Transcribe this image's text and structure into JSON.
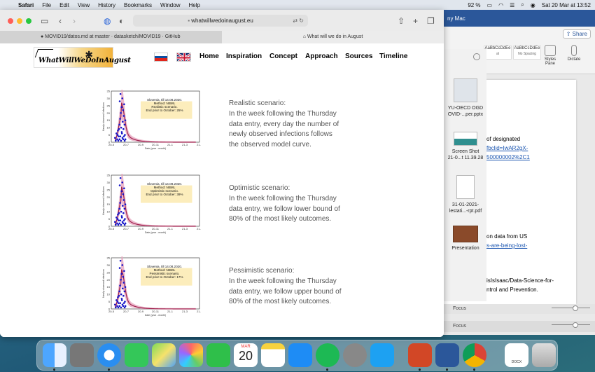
{
  "menubar": {
    "app": "Safari",
    "items": [
      "File",
      "Edit",
      "View",
      "History",
      "Bookmarks",
      "Window",
      "Help"
    ],
    "battery": "92 %",
    "datetime": "Sat 20 Mar at 13:52"
  },
  "browser": {
    "address": "whatwillwedoinaugust.eu",
    "tabs": [
      {
        "label": "MOVID19/datos.md at master · datasketch/MOVID19 · GitHub"
      },
      {
        "label": "What will we do in August"
      }
    ]
  },
  "site": {
    "logo_text": "WhatWillWeDoInAugust",
    "nav": [
      "Home",
      "Inspiration",
      "Concept",
      "Approach",
      "Sources",
      "Timeline"
    ]
  },
  "chart_common": {
    "ylabel": "Newly observed infections",
    "xlabel": "Date (year - month)",
    "yticks": [
      0,
      5,
      10,
      15,
      20,
      25,
      30,
      35
    ],
    "xticks": [
      "20-5",
      "20-7",
      "20-9",
      "20-11",
      "21-1",
      "21-3",
      "21-5"
    ],
    "points": [
      [
        0.5,
        3
      ],
      [
        0.6,
        1
      ],
      [
        0.7,
        6
      ],
      [
        0.8,
        2
      ],
      [
        0.9,
        8
      ],
      [
        1.0,
        4
      ],
      [
        1.1,
        12
      ],
      [
        1.15,
        28
      ],
      [
        1.2,
        16
      ],
      [
        1.25,
        33
      ],
      [
        1.3,
        20
      ],
      [
        1.35,
        10
      ],
      [
        1.4,
        24
      ],
      [
        1.45,
        6
      ],
      [
        1.5,
        30
      ],
      [
        1.55,
        14
      ],
      [
        1.6,
        22
      ],
      [
        1.65,
        9
      ],
      [
        1.7,
        18
      ],
      [
        1.75,
        26
      ],
      [
        1.8,
        12
      ],
      [
        1.85,
        5
      ],
      [
        1.9,
        15
      ],
      [
        0.95,
        1
      ],
      [
        1.05,
        9
      ],
      [
        0.85,
        5
      ],
      [
        1.12,
        2
      ],
      [
        1.22,
        4
      ],
      [
        1.32,
        1
      ],
      [
        1.42,
        7
      ],
      [
        1.52,
        3
      ],
      [
        1.62,
        2
      ],
      [
        1.72,
        4
      ],
      [
        1.82,
        1
      ],
      [
        1.92,
        2
      ]
    ]
  },
  "scenarios": [
    {
      "chart_title": "Slovenia, till 14.08.2020.",
      "chart_method": "Method: NBML",
      "chart_scenario": "Realistic scenario.",
      "chart_end": "End prior to October: 25%",
      "title": "Realistic scenario:",
      "lines": [
        "In the week following the Thursday",
        "data entry, every day the number of",
        "newly observed infections follows",
        "the observed model curve."
      ]
    },
    {
      "chart_title": "Slovenia, till 14.08.2020.",
      "chart_method": "Method: NBML",
      "chart_scenario": "Optimistic scenario.",
      "chart_end": "End prior to October: 39%",
      "title": "Optimistic scenario:",
      "lines": [
        "In the week following the Thursday",
        "data entry, we follow lower bound of",
        "80% of the most likely outcomes."
      ]
    },
    {
      "chart_title": "Slovenia, till 14.08.2020.",
      "chart_method": "Method: NBML",
      "chart_scenario": "Pessimistic scenario.",
      "chart_end": "End prior to October: 17%",
      "title": "Pessimistic scenario:",
      "lines": [
        "In the week following the Thursday",
        "data entry, we follow upper bound of",
        "80% of the most likely outcomes."
      ]
    }
  ],
  "word": {
    "title": "ny Mac",
    "share": "Share",
    "style1": "AaBbCcDdEe",
    "style1_label": "al",
    "style2": "AaBbCcDdEe",
    "style2_label": "No Spacing",
    "styles_pane": "Styles Pane",
    "dictate": "Dictate",
    "doc_lines": [
      {
        "text": "of designated",
        "link": false
      },
      {
        "text": "fbclid=IwAR2gX-",
        "link": true
      },
      {
        "text": "500000002%2C1",
        "link": true
      },
      {
        "text": "on data from US",
        "link": false
      },
      {
        "text": "s-are-being-lost-",
        "link": true
      },
      {
        "text": "isIsIsaac/Data-Science-for-",
        "link": false
      },
      {
        "text": "ntrol and Prevention.",
        "link": false
      }
    ],
    "focus": "Focus",
    "focus2": "Focus"
  },
  "files": [
    {
      "l1": "YU-OECD OGD",
      "l2": "OVID-...per.pptx"
    },
    {
      "l1": "Screen Shot",
      "l2": "21-0...t 11.39.28"
    },
    {
      "l1": "31-01-2021-",
      "l2": "lestati...-rpt.pdf"
    },
    {
      "l1": "Presentation",
      "l2": ""
    }
  ],
  "dock": {
    "calendar_month": "MAR",
    "calendar_day": "20",
    "docx_label": "DOCX"
  }
}
